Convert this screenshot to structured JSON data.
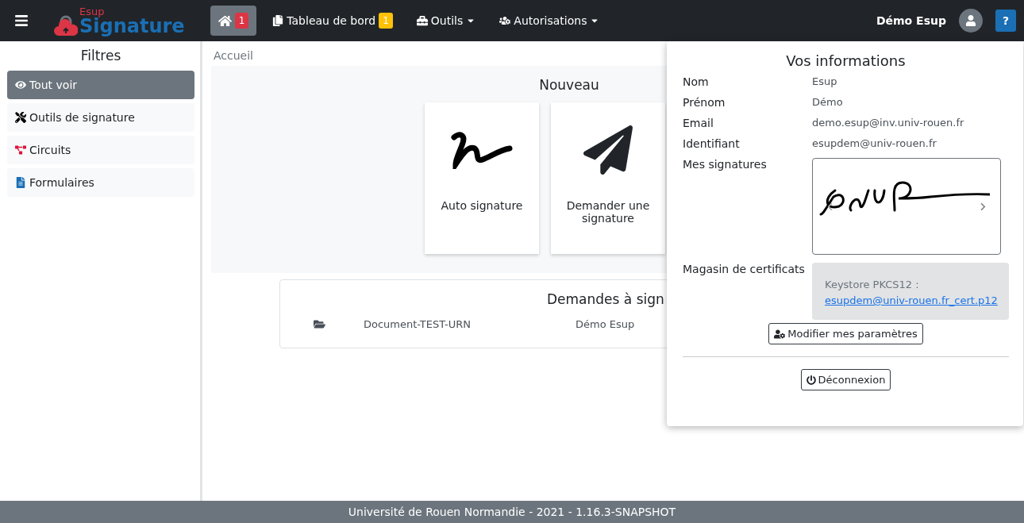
{
  "navbar": {
    "logo_small": "Esup",
    "logo_main": "Signature",
    "items": [
      {
        "kind": "home",
        "badge": "1",
        "selected": true
      },
      {
        "kind": "link",
        "label": "Tableau de bord",
        "badge": "1",
        "selected": false
      },
      {
        "kind": "dropdown",
        "label": "Outils",
        "selected": false
      },
      {
        "kind": "dropdown",
        "label": "Autorisations",
        "selected": false
      }
    ],
    "user": "Démo Esup",
    "help": "?"
  },
  "sidebar": {
    "title": "Filtres",
    "items": [
      {
        "label": "Tout voir",
        "selected": true
      },
      {
        "label": "Outils de signature",
        "selected": false
      },
      {
        "label": "Circuits",
        "selected": false
      },
      {
        "label": "Formulaires",
        "selected": false
      }
    ]
  },
  "breadcrumb": "Accueil",
  "nouveau": {
    "title": "Nouveau",
    "cards": [
      {
        "label": "Auto signature"
      },
      {
        "label": "Demander une signature"
      }
    ]
  },
  "demandes": {
    "title": "Demandes à sign",
    "rows": [
      {
        "name": "Document-TEST-URN",
        "creator": "Démo Esup"
      }
    ]
  },
  "user_panel": {
    "title": "Vos informations",
    "fields": [
      {
        "label": "Nom",
        "value": "Esup"
      },
      {
        "label": "Prénom",
        "value": "Démo"
      },
      {
        "label": "Email",
        "value": "demo.esup@inv.univ-rouen.fr"
      },
      {
        "label": "Identifiant",
        "value": "esupdem@univ-rouen.fr"
      }
    ],
    "signatures_label": "Mes signatures",
    "certificates_label": "Magasin de certificats",
    "keystore_label": "Keystore PKCS12 :",
    "keystore_file": "esupdem@univ-rouen.fr_cert.p12",
    "settings_button": "Modifier mes paramètres",
    "logout_button": "Déconnexion"
  },
  "footer": "Université de Rouen Normandie - 2021 - 1.16.3-SNAPSHOT"
}
